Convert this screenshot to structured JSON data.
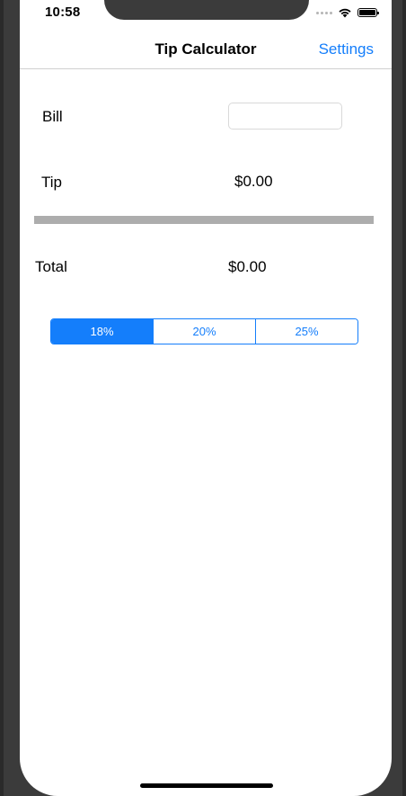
{
  "status_bar": {
    "time": "10:58",
    "icons": [
      "signal-dots-icon",
      "wifi-icon",
      "battery-icon"
    ]
  },
  "nav": {
    "title": "Tip Calculator",
    "settings_label": "Settings"
  },
  "bill": {
    "label": "Bill",
    "value": "",
    "placeholder": ""
  },
  "tip": {
    "label": "Tip",
    "value": "$0.00"
  },
  "total": {
    "label": "Total",
    "value": "$0.00"
  },
  "tip_options": {
    "items": [
      {
        "label": "18%",
        "selected": true
      },
      {
        "label": "20%",
        "selected": false
      },
      {
        "label": "25%",
        "selected": false
      }
    ],
    "selected_index": 0
  },
  "colors": {
    "accent": "#147efb",
    "divider": "#adadad",
    "bezel": "#3b3b3b",
    "background": "#ffffff"
  }
}
